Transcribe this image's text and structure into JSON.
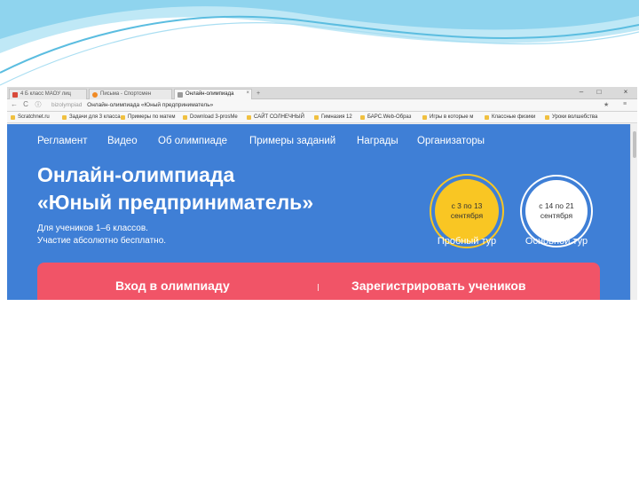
{
  "browser": {
    "tabs": [
      {
        "label": "4 Б класс МАОУ лиц",
        "color": "#d84a3a"
      },
      {
        "label": "Письма - Спортсмен",
        "color": "#f08a24"
      },
      {
        "label": "Онлайн-олимпиада",
        "color": "#9a9a9a"
      }
    ],
    "new_tab": "+",
    "window_controls": {
      "minimize": "–",
      "maximize": "□",
      "close": "×"
    },
    "address": {
      "back": "←",
      "reload": "C",
      "host": "bizolympiad",
      "title": "Онлайн-олимпиада «Юный предприниматель»",
      "star": "★",
      "menu": "≡"
    },
    "bookmarks": [
      "Scratchnet.ru",
      "Задачи для 3 класса",
      "Примеры по матем",
      "Download 3-prosMe",
      "САЙТ СОЛНЕЧНЫЙ",
      "Гимназия 12",
      "БАРС.Web-Образ",
      "Игры в которые м",
      "Классные физики",
      "Уроки волшебства"
    ]
  },
  "page": {
    "menu": [
      "Регламент",
      "Видео",
      "Об олимпиаде",
      "Примеры заданий",
      "Награды",
      "Организаторы"
    ],
    "title_line1": "Онлайн-олимпиада",
    "title_line2": "«Юный предприниматель»",
    "subtitle_line1": "Для учеников 1–6 классов.",
    "subtitle_line2": "Участие абсолютно бесплатно.",
    "tours": [
      {
        "dates": "с 3 по 13 сентября",
        "label": "Пробный тур",
        "fill": "#f9c623",
        "ring": "#f9c623"
      },
      {
        "dates": "с 14 по 21 сентября",
        "label": "Основной тур",
        "fill": "#ffffff",
        "ring": "#ffffff"
      }
    ],
    "cta": {
      "login": "Вход в олимпиаду",
      "register": "Зарегистрировать учеников"
    }
  },
  "colors": {
    "page_blue": "#3f7fd6",
    "cta_red": "#f15467",
    "swoosh_blue": "#8fd4ee"
  }
}
